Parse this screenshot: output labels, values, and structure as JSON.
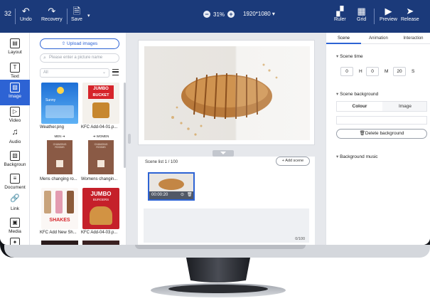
{
  "toolbar": {
    "number": "32",
    "undo": "Undo",
    "recovery": "Recovery",
    "save": "Save",
    "zoom": "31%",
    "resolution": "1920*1080 ▾",
    "ruler": "Ruler",
    "grid": "Grid",
    "preview": "Preview",
    "release": "Release"
  },
  "sidebar": {
    "items": [
      {
        "label": "Layout",
        "icon": "layout-icon"
      },
      {
        "label": "Text",
        "icon": "text-icon"
      },
      {
        "label": "Image",
        "icon": "image-icon"
      },
      {
        "label": "Video",
        "icon": "video-icon"
      },
      {
        "label": "Audio",
        "icon": "audio-icon"
      },
      {
        "label": "Backgroun",
        "icon": "background-icon"
      },
      {
        "label": "Document",
        "icon": "document-icon"
      },
      {
        "label": "Link",
        "icon": "link-icon"
      },
      {
        "label": "Media",
        "icon": "media-icon"
      }
    ]
  },
  "media": {
    "upload_label": "Upload images",
    "search_placeholder": "Please enter a picture name",
    "filter_value": "All",
    "items": [
      {
        "label": "Weather.png"
      },
      {
        "label": "KFC Add-04-01.p..."
      },
      {
        "label": "Mens changing ro..."
      },
      {
        "label": "Womens changin..."
      },
      {
        "label": "KFC Add New Sh..."
      },
      {
        "label": "KFC Add-04-03.p..."
      }
    ],
    "thumb_text": {
      "weather": "Sunny",
      "jumbo": "JUMBO",
      "bucket": "BUCKET",
      "men": "MEN ➔",
      "women": "➔ WOMEN",
      "changing": "CHANGING ROOMS",
      "shakes": "SHAKES",
      "burger": "BURGERS"
    }
  },
  "canvas": {
    "scene_list_label": "Scene list 1 / 100",
    "add_scene_label": "+ Add scene",
    "scene_time": "00:00:20",
    "scene_count": "0/100"
  },
  "props": {
    "tabs": [
      "Scene",
      "Animation",
      "Interaction"
    ],
    "scene_time_title": "Scene time",
    "time": {
      "h": "0",
      "m": "0",
      "s": "20",
      "h_unit": "H",
      "m_unit": "M",
      "s_unit": "S"
    },
    "background_title": "Scene background",
    "colour": "Colour",
    "image": "Image",
    "delete_bg": "Delete background",
    "music_title": "Background music"
  },
  "colors": {
    "toolbar": "#1b3a7a",
    "accent": "#2d63d4"
  }
}
